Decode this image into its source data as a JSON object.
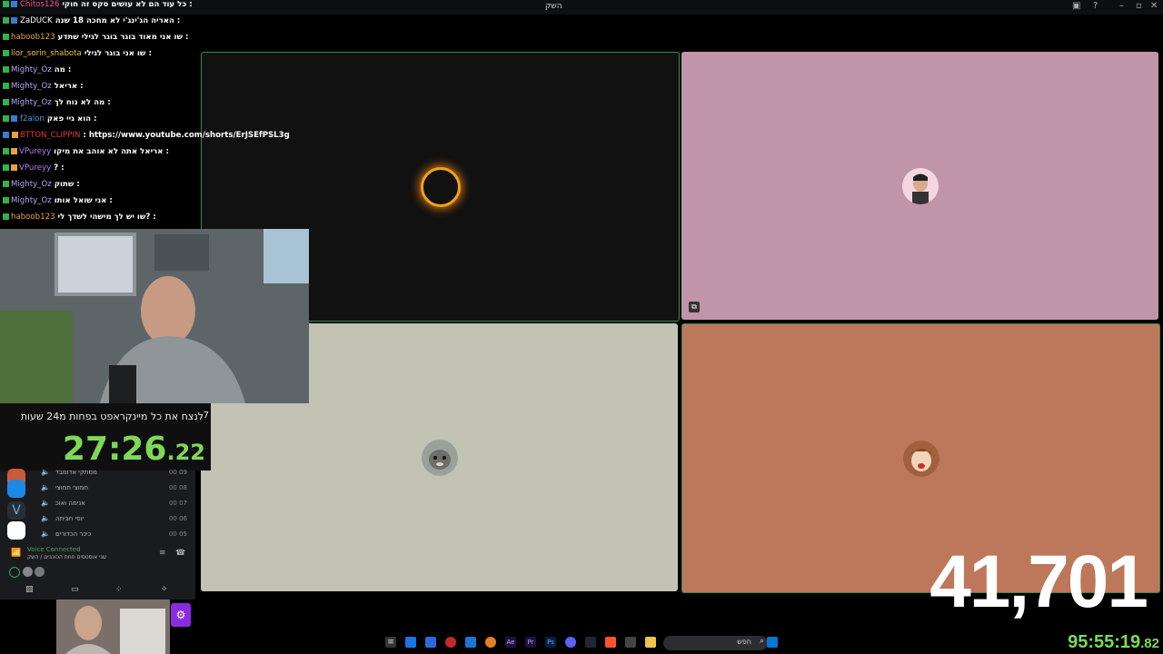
{
  "window": {
    "title": "השק"
  },
  "chat": [
    {
      "user": "Chitos126",
      "color": "#e84b8a",
      "msg": "כל עוד הם לא עושים סקס זה חוקי :"
    },
    {
      "user": "ZaDUCK",
      "color": "#ffffff",
      "msg": "האריה הג'ינג'י לא מחכה 18 שנה :"
    },
    {
      "user": "haboob123",
      "color": "#e8a13a",
      "msg": "שו אני מאוד בוגר בוגר לגילי שתדע :"
    },
    {
      "user": "lior_sorin_shabota",
      "color": "#f0c02a",
      "msg": "שו אני בוגר לגילי :"
    },
    {
      "user": "Mighty_Oz",
      "color": "#b8a7f2",
      "msg": "מה :"
    },
    {
      "user": "Mighty_Oz",
      "color": "#b8a7f2",
      "msg": "אריאל :"
    },
    {
      "user": "Mighty_Oz",
      "color": "#b8a7f2",
      "msg": "מה לא נוח לך :"
    },
    {
      "user": "f2alon",
      "color": "#4b9be8",
      "msg": "הוא גיי פאק :"
    },
    {
      "user": "BTTON_CLIPPIN",
      "color": "#e03a3a",
      "msg": ": https://www.youtube.com/shorts/ErJSEfPSL3g"
    },
    {
      "user": "VPureyy",
      "color": "#b77ef2",
      "msg": "אריאל אתה לא אוהב את מיקו :"
    },
    {
      "user": "VPureyy",
      "color": "#b77ef2",
      "msg": "? :"
    },
    {
      "user": "Mighty_Oz",
      "color": "#b8a7f2",
      "msg": "שתוק :"
    },
    {
      "user": "Mighty_Oz",
      "color": "#b8a7f2",
      "msg": "אני שואל אותו :"
    },
    {
      "user": "haboob123",
      "color": "#e8a13a",
      "msg": "שו יש לך מישהי לשדך לי? :"
    }
  ],
  "timer": {
    "title": "לנצח את כל מיינקראפט בפחות מ24 שעות",
    "step": "7",
    "main": "27:26",
    "fraction": ".22"
  },
  "voice_channel": {
    "connected_label": "Voice Connected",
    "channel_sub": "שני אוסטסים תחת הכוכבים / השק",
    "members": [
      {
        "name": "ממתקי אדומבד",
        "tag": "00 09"
      },
      {
        "name": "חמוצי חמוצי",
        "tag": "00 08"
      },
      {
        "name": "אנימה ואוכ",
        "tag": "00 07"
      },
      {
        "name": "יוסי חביתה",
        "tag": "00 06"
      },
      {
        "name": "כיכר הכדורים",
        "tag": "00 05"
      }
    ]
  },
  "counter": {
    "value": "41,701"
  },
  "uptime": {
    "value": "95:55:19",
    "fraction": ".82"
  },
  "taskbar": {
    "search_label": "חפש"
  }
}
